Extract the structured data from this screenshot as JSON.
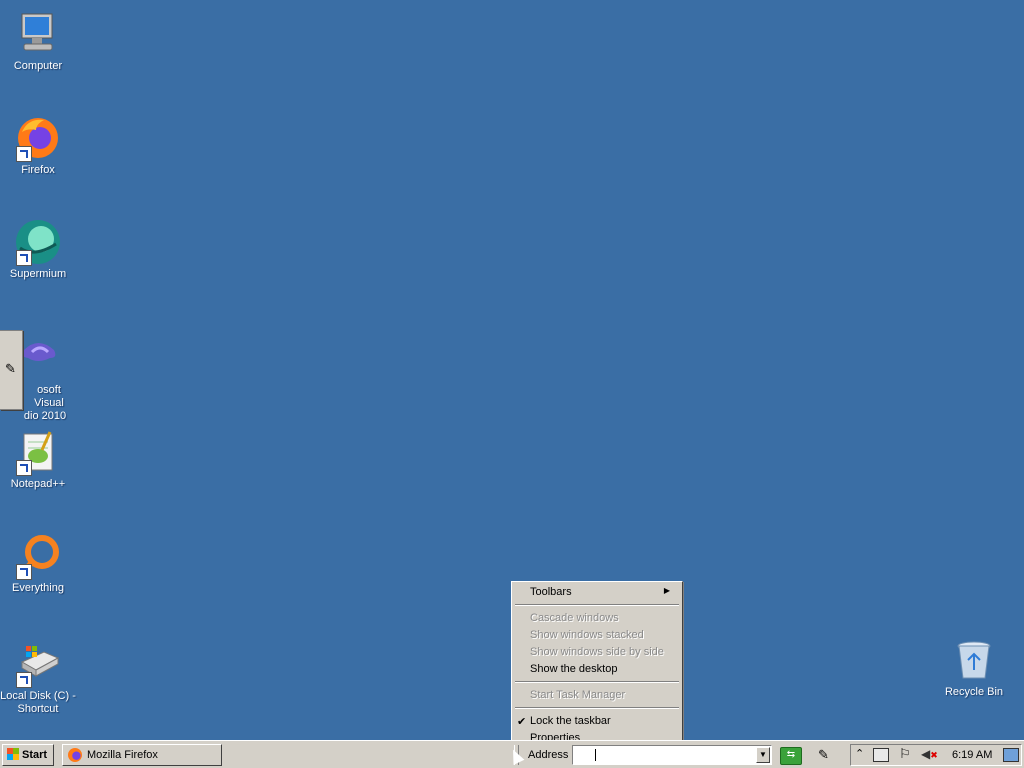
{
  "desktop": {
    "background": "#3a6ea5",
    "icons": [
      {
        "label": "Computer",
        "icon": "computer-icon",
        "shortcut": false
      },
      {
        "label": "Firefox",
        "icon": "firefox-icon",
        "shortcut": true
      },
      {
        "label": "Supermium",
        "icon": "supermium-icon",
        "shortcut": true
      },
      {
        "label_line1": "osoft Visual",
        "label_line2": "dio 2010",
        "icon": "visual-studio-icon",
        "shortcut": false
      },
      {
        "label": "Notepad++",
        "icon": "notepadpp-icon",
        "shortcut": true
      },
      {
        "label": "Everything",
        "icon": "everything-icon",
        "shortcut": true
      },
      {
        "label_line1": "Local Disk (C) -",
        "label_line2": "Shortcut",
        "icon": "local-disk-icon",
        "shortcut": true
      },
      {
        "label": "Recycle Bin",
        "icon": "recycle-bin-icon",
        "shortcut": false
      }
    ]
  },
  "context_menu": {
    "items": [
      {
        "label": "Toolbars",
        "enabled": true,
        "submenu": true
      },
      {
        "label": "Cascade windows",
        "enabled": false
      },
      {
        "label": "Show windows stacked",
        "enabled": false
      },
      {
        "label": "Show windows side by side",
        "enabled": false
      },
      {
        "label": "Show the desktop",
        "enabled": true
      },
      {
        "label": "Start Task Manager",
        "enabled": false
      },
      {
        "label": "Lock the taskbar",
        "enabled": true,
        "checked": true
      },
      {
        "label": "Properties",
        "enabled": true
      }
    ]
  },
  "taskbar": {
    "start_label": "Start",
    "task_button": "Mozilla Firefox",
    "address_label": "Address",
    "address_value": "",
    "clock": "6:19 AM"
  }
}
